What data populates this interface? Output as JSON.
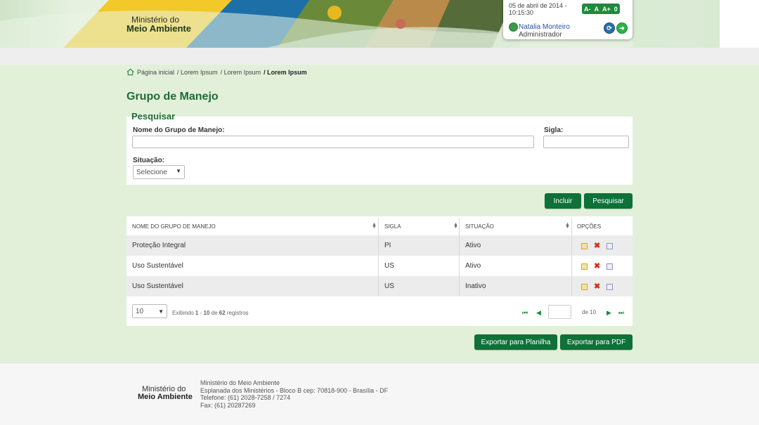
{
  "header": {
    "org_line1": "Ministério do",
    "org_line2": "Meio Ambiente",
    "datetime": "05 de abril de 2014 - 10:15:30",
    "font_controls": [
      "A-",
      "A",
      "A+",
      "0"
    ],
    "user_name": "Natalia Monteiro",
    "user_role": "Administrador"
  },
  "breadcrumb": {
    "items": [
      "Página inicial",
      "/ Lorem Ipsum",
      "/ Lorem Ipsum",
      "/ Lorem Ipsum"
    ]
  },
  "page_title": "Grupo de Manejo",
  "search": {
    "legend": "Pesquisar",
    "name_label": "Nome do Grupo de Manejo:",
    "name_value": "",
    "sigla_label": "Sigla:",
    "sigla_value": "",
    "situacao_label": "Situação:",
    "situacao_value": "Selecione"
  },
  "actions": {
    "incluir": "Incluir",
    "pesquisar": "Pesquisar"
  },
  "table": {
    "headers": [
      "NOME DO GRUPO DE MANEJO",
      "SIGLA",
      "SITUAÇÃO",
      "OPÇÕES"
    ],
    "rows": [
      {
        "nome": "Proteção Integral",
        "sigla": "PI",
        "situacao": "Ativo"
      },
      {
        "nome": "Uso Sustentável",
        "sigla": "US",
        "situacao": "Ativo"
      },
      {
        "nome": "Uso Sustentável",
        "sigla": "US",
        "situacao": "Inativo"
      }
    ]
  },
  "pagination": {
    "page_size": "10",
    "info_prefix": "Exibindo ",
    "info_from": "1",
    "info_sep": " - ",
    "info_to": "10",
    "info_mid": " de ",
    "info_total": "62",
    "info_suffix": " registros",
    "page_value": "",
    "of_label": "de 10"
  },
  "export": {
    "sheet": "Exportar para Planilha",
    "pdf": "Exportar para PDF"
  },
  "footer": {
    "logo1": "Ministério do",
    "logo2": "Meio Ambiente",
    "lines": [
      "Ministério do Meio Ambiente",
      "Esplanada dos Ministérios - Bloco B cep: 70818-900 - Brasília - DF",
      "Telefone: (61) 2028-7258 / 7274",
      "Fax: (61) 20287269"
    ]
  },
  "colors": {
    "primary_green": "#0e7138",
    "title_green": "#1f6b33",
    "bg_green": "#e2f0da"
  }
}
